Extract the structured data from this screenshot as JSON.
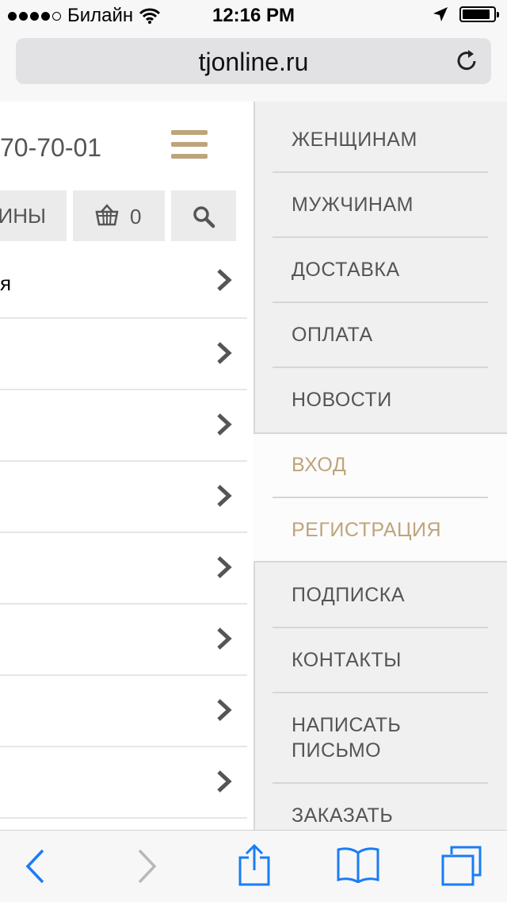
{
  "status_bar": {
    "carrier": "Билайн",
    "time": "12:16 PM"
  },
  "browser": {
    "url": "tjonline.ru"
  },
  "page": {
    "phone": "70-70-01",
    "shops_label": "ИНЫ",
    "cart_count": "0",
    "rows": [
      {
        "text": "я"
      },
      {
        "text": ""
      },
      {
        "text": ""
      },
      {
        "text": ""
      },
      {
        "text": ""
      },
      {
        "text": ""
      },
      {
        "text": ""
      },
      {
        "text": ""
      }
    ]
  },
  "menu": {
    "items": [
      {
        "label": "ЖЕНЩИНАМ"
      },
      {
        "label": "МУЖЧИНАМ"
      },
      {
        "label": "ДОСТАВКА"
      },
      {
        "label": "ОПЛАТА"
      },
      {
        "label": "НОВОСТИ"
      },
      {
        "label": "ВХОД"
      },
      {
        "label": "РЕГИСТРАЦИЯ"
      },
      {
        "label": "ПОДПИСКА"
      },
      {
        "label": "КОНТАКТЫ"
      },
      {
        "label": "НАПИСАТЬ ПИСЬМО"
      },
      {
        "label": "ЗАКАЗАТЬ"
      }
    ]
  },
  "colors": {
    "accent_gold": "#bea47b",
    "ios_blue": "#1a7cf5"
  },
  "icons": [
    "signal-dots",
    "wifi-icon",
    "location-arrow-icon",
    "battery-icon",
    "reload-icon",
    "hamburger-icon",
    "basket-icon",
    "search-icon",
    "chevron-right-icon",
    "back-icon",
    "forward-icon",
    "share-icon",
    "bookmarks-icon",
    "tabs-icon"
  ]
}
